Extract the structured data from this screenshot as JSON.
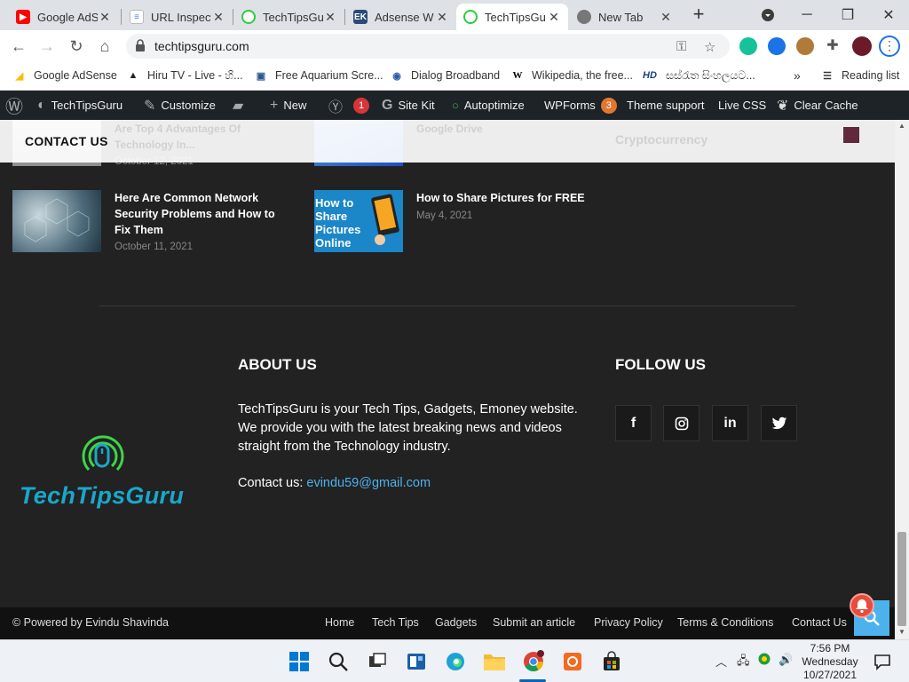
{
  "browser": {
    "tabs": [
      {
        "title": "Google AdS",
        "icon": "youtube-icon",
        "color": "#ff0000",
        "active": false
      },
      {
        "title": "URL Inspect",
        "icon": "search-console-icon",
        "color": "#4285f4",
        "active": false
      },
      {
        "title": "TechTipsGu",
        "icon": "techtipsguru-icon",
        "color": "#2ecc40",
        "active": false
      },
      {
        "title": "Adsense W",
        "icon": "ek-icon",
        "color": "#2b4a7a",
        "active": false
      },
      {
        "title": "TechTipsGu",
        "icon": "techtipsguru-icon",
        "color": "#2ecc40",
        "active": true
      },
      {
        "title": "New Tab",
        "icon": "chrome-icon",
        "color": "#555555",
        "active": false
      }
    ],
    "url": "techtipsguru.com",
    "bookmarks": [
      {
        "label": "Google AdSense",
        "icon": "adsense-icon"
      },
      {
        "label": "Hiru TV - Live - හි...",
        "icon": "hiru-icon"
      },
      {
        "label": "Free Aquarium Scre...",
        "icon": "aquarium-icon"
      },
      {
        "label": "Dialog Broadband",
        "icon": "dialog-icon"
      },
      {
        "label": "Wikipedia, the free...",
        "icon": "wikipedia-icon"
      },
      {
        "label": "සස්රැත සිංහලයට...",
        "icon": "hd-icon"
      }
    ],
    "bookmarks_more": "»",
    "reading_list": "Reading list"
  },
  "adminbar": {
    "site": "TechTipsGuru",
    "customize": "Customize",
    "new": "New",
    "yoast_badge": "1",
    "site_kit": "Site Kit",
    "autoptimize": "Autoptimize",
    "wpforms": "WPForms",
    "wpforms_badge": "3",
    "theme_support": "Theme support",
    "live_css": "Live CSS",
    "clear_cache": "Clear Cache"
  },
  "sticky": {
    "contact": "CONTACT US",
    "faded_1": "Are Top 4 Advantages Of",
    "faded_2": "Technology In...",
    "faded_3": "Google Drive",
    "faded_4": "Cryptocurrency"
  },
  "posts": [
    {
      "title": "Here Are Common Network Security Problems and How to Fix Them",
      "date": "October 11, 2021"
    },
    {
      "title": "How to Share Pictures for FREE",
      "date": "May 4, 2021",
      "thumb_text": "How to Share Pictures Online"
    }
  ],
  "prev_post_date": "October 12, 2021",
  "footer": {
    "logo_text": "TechTipsGuru",
    "about_heading": "ABOUT US",
    "about_text": "TechTipsGuru is your Tech Tips, Gadgets, Emoney website. We provide you with the latest breaking news and videos straight from the Technology industry.",
    "contact_label": "Contact us:",
    "contact_email": "evindu59@gmail.com",
    "follow_heading": "FOLLOW US",
    "social": [
      {
        "name": "facebook",
        "glyph": "f"
      },
      {
        "name": "instagram",
        "glyph": "◎"
      },
      {
        "name": "linkedin",
        "glyph": "in"
      },
      {
        "name": "twitter",
        "glyph": "🐦"
      }
    ],
    "copyright": "© Powered by Evindu Shavinda",
    "links": [
      "Home",
      "Tech Tips",
      "Gadgets",
      "Submit an article",
      "Privacy Policy",
      "Terms & Conditions",
      "Contact Us"
    ]
  },
  "taskbar": {
    "time": "7:56 PM",
    "day": "Wednesday",
    "date": "10/27/2021"
  }
}
